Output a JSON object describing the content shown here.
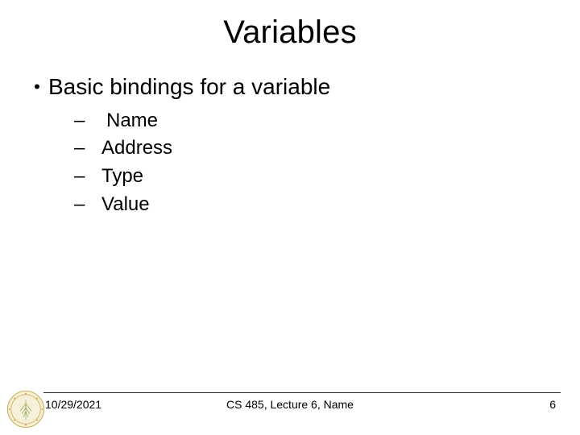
{
  "title": "Variables",
  "bullet_l1": "Basic bindings for a variable",
  "sub_items": {
    "a": "Name",
    "b": "Address",
    "c": "Type",
    "d": "Value"
  },
  "footer": {
    "date": "10/29/2021",
    "center": "CS 485, Lecture 6, Name",
    "page": "6"
  },
  "seal": {
    "name": "university-seal"
  }
}
